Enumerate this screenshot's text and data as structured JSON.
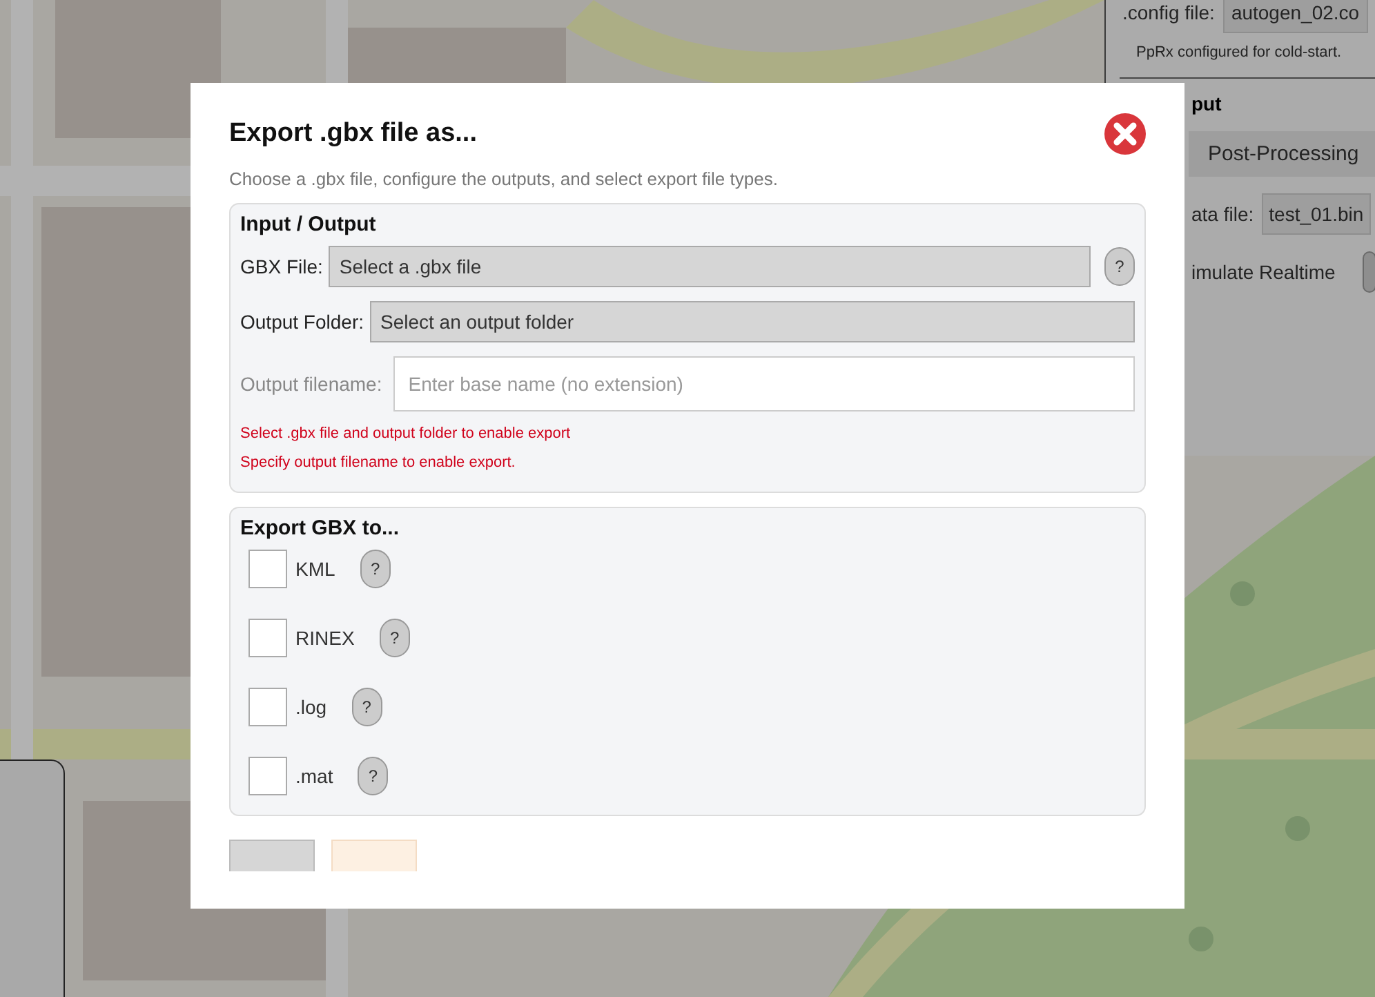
{
  "background_panel": {
    "config_label": ".config file:",
    "config_value": "autogen_02.co",
    "status": "PpRx configured for cold-start.",
    "heading": "put",
    "mode_button": "Post-Processing",
    "data_file_label": "ata file:",
    "data_file_value": "test_01.bin",
    "simulate_label": "imulate Realtime"
  },
  "dialog": {
    "title": "Export .gbx file as...",
    "subtitle": "Choose a .gbx file, configure the outputs, and select export file types.",
    "input_output": {
      "heading": "Input / Output",
      "gbx_file": {
        "label": "GBX File:",
        "prompt": "Select a .gbx file",
        "help": "?"
      },
      "output_folder": {
        "label": "Output Folder:",
        "prompt": "Select an output folder"
      },
      "output_filename": {
        "label": "Output filename:",
        "placeholder": "Enter base name (no extension)",
        "disabled": true
      },
      "messages": [
        "Select .gbx file and output folder to enable export",
        "Specify output filename to enable export."
      ]
    },
    "export": {
      "heading": "Export GBX to...",
      "formats": [
        {
          "label": "KML",
          "checked": false,
          "help": "?"
        },
        {
          "label": "RINEX",
          "checked": false,
          "help": "?"
        },
        {
          "label": ".log",
          "checked": false,
          "help": "?"
        },
        {
          "label": ".mat",
          "checked": false,
          "help": "?"
        }
      ]
    },
    "footer_buttons": [
      {
        "kind": "secondary"
      },
      {
        "kind": "primary"
      }
    ]
  }
}
